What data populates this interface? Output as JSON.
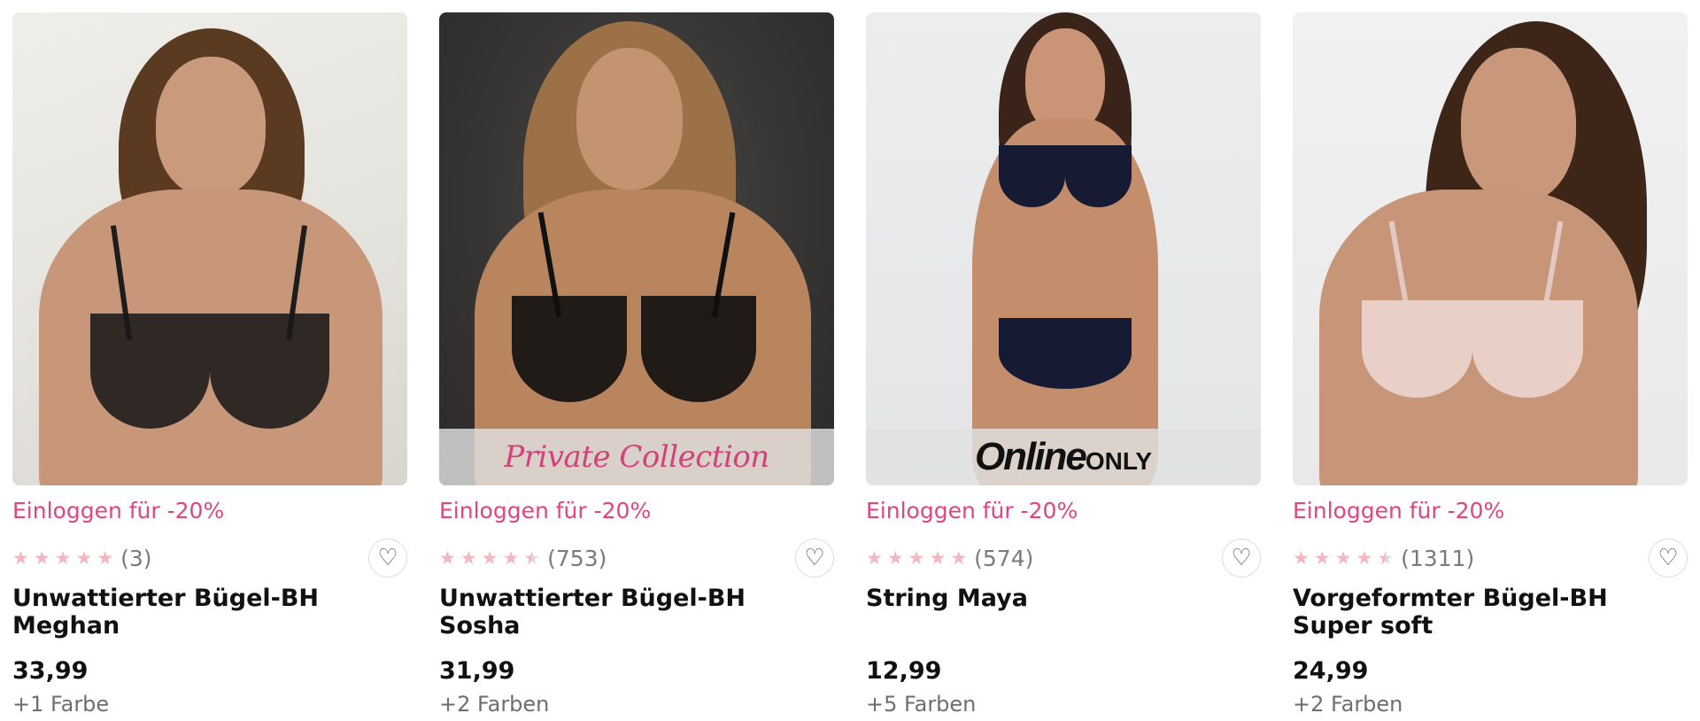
{
  "products": [
    {
      "promo": "Einloggen für -20%",
      "rating_count": "(3)",
      "rating": 5,
      "name": "Unwattierter Bügel-BH Meghan",
      "price": "33,99",
      "colors": "+1 Farbe",
      "badge": ""
    },
    {
      "promo": "Einloggen für -20%",
      "rating_count": "(753)",
      "rating": 4.5,
      "name": "Unwattierter Bügel-BH Sosha",
      "price": "31,99",
      "colors": "+2 Farben",
      "badge": "Private Collection"
    },
    {
      "promo": "Einloggen für -20%",
      "rating_count": "(574)",
      "rating": 5,
      "name": "String Maya",
      "price": "12,99",
      "colors": "+5 Farben",
      "badge_online_1": "Online",
      "badge_online_2": "ONLY"
    },
    {
      "promo": "Einloggen für -20%",
      "rating_count": "(1311)",
      "rating": 4.5,
      "name": "Vorgeformter Bügel-BH Super soft",
      "price": "24,99",
      "colors": "+2 Farben",
      "badge": ""
    }
  ],
  "icons": {
    "star": "star-icon",
    "wishlist": "heart-outline-icon"
  },
  "colors": {
    "promo": "#e0467d",
    "star": "#f4b6bf",
    "text": "#111111"
  }
}
